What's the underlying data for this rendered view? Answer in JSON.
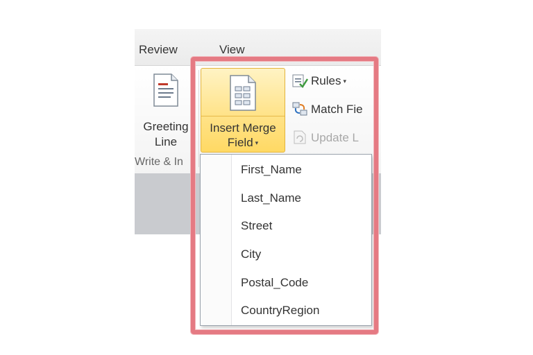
{
  "tabs": [
    {
      "label": "Review"
    },
    {
      "label": "View"
    }
  ],
  "greeting": {
    "label_line1": "Greeting",
    "label_line2": "Line",
    "group_label": "Write & In"
  },
  "insert_merge_field": {
    "label_line1": "Insert Merge",
    "label_line2": "Field",
    "caret": "▾"
  },
  "commands": [
    {
      "label": "Rules",
      "caret": "▾",
      "icon": "rules-icon"
    },
    {
      "label": "Match Fie",
      "icon": "match-fields-icon"
    },
    {
      "label": "Update L",
      "icon": "update-labels-icon",
      "disabled": true
    }
  ],
  "menu": {
    "items": [
      {
        "label": "First_Name"
      },
      {
        "label": "Last_Name"
      },
      {
        "label": "Street"
      },
      {
        "label": "City"
      },
      {
        "label": "Postal_Code"
      },
      {
        "label": "CountryRegion"
      }
    ]
  },
  "colors": {
    "highlight": "#e57a83",
    "button_active": "#ffe38a"
  }
}
